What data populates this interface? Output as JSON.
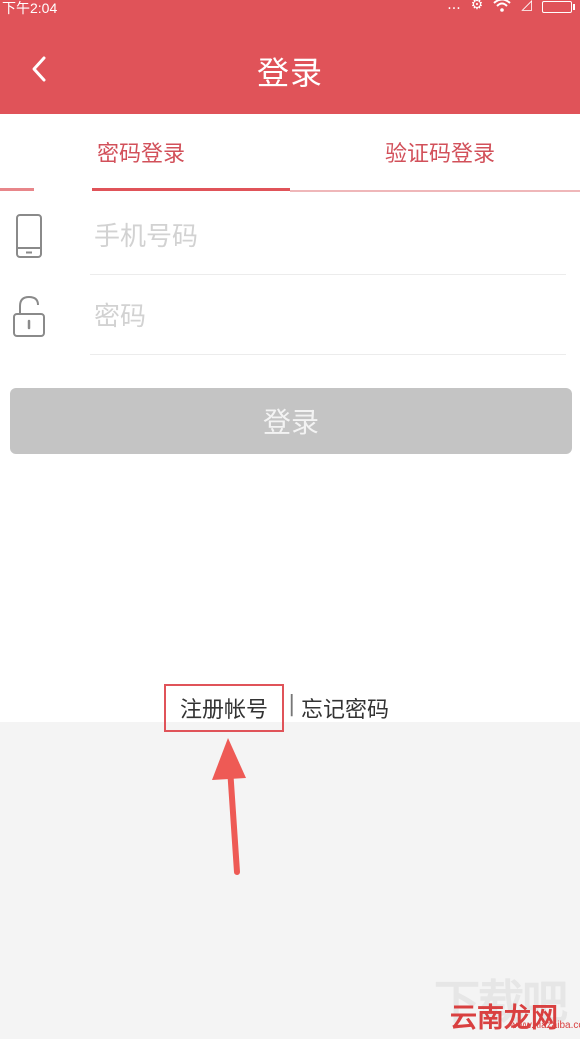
{
  "status_bar": {
    "time": "下午2:04",
    "signal_dots": "..."
  },
  "header": {
    "title": "登录",
    "back_icon": "chevron-left-icon"
  },
  "tabs": [
    {
      "label": "密码登录",
      "active": true
    },
    {
      "label": "验证码登录",
      "active": false
    }
  ],
  "form": {
    "phone": {
      "placeholder": "手机号码",
      "value": "",
      "icon": "phone-icon"
    },
    "password": {
      "placeholder": "密码",
      "value": "",
      "icon": "lock-icon"
    },
    "login_label": "登录"
  },
  "links": {
    "register": "注册帐号",
    "separator": "|",
    "forgot": "忘记密码"
  },
  "watermark": {
    "big": "下载吧",
    "brand": "云南龙网",
    "url": "www.xiazaiba.com"
  },
  "colors": {
    "accent": "#e05359",
    "disabled_button": "#c4c4c4",
    "background": "#f4f4f4"
  }
}
